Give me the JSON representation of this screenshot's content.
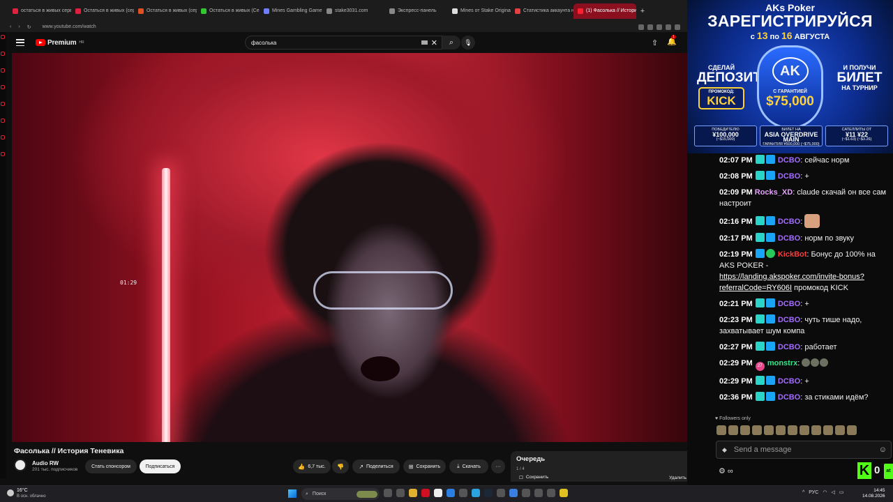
{
  "browser": {
    "tabs": [
      {
        "label": "остаться в живых серв",
        "color": "#e02040"
      },
      {
        "label": "Остаться в живых (сер",
        "color": "#e02040"
      },
      {
        "label": "Остаться в живых (серв",
        "color": "#e05020"
      },
      {
        "label": "Остаться в живых (Сер",
        "color": "#32c832"
      },
      {
        "label": "Mines Gambling Game b",
        "color": "#6f7dff"
      },
      {
        "label": "stake3031.com",
        "color": "#888888"
      },
      {
        "label": "Экспресс-панель",
        "color": "#888888"
      },
      {
        "label": "Mines от Stake Originals",
        "color": "#dddddd"
      },
      {
        "label": "Статистика аккаунта н",
        "color": "#e04040"
      },
      {
        "label": "(1) Фасолька // Истори",
        "color": "#ff2030",
        "active": true
      }
    ],
    "url": "www.youtube.com/watch"
  },
  "youtube": {
    "logo_text": "Premium",
    "logo_region": "HR",
    "search_query": "фасолька",
    "notif_count": "1",
    "overlay_time": "01:29",
    "video_title": "Фасолька // История Теневика",
    "channel_name": "Audio RW",
    "channel_subs": "201 тыс. подписчиков",
    "sponsor_label": "Стать спонсором",
    "subscribe_label": "Подписаться",
    "like_count": "6,7 тыс.",
    "share_label": "Поделиться",
    "save_label": "Сохранить",
    "download_label": "Скачать",
    "more_label": "···",
    "queue": {
      "title": "Очередь",
      "count": "1 / 4",
      "save_label": "Сохранить",
      "delete_label": "Удалить все"
    }
  },
  "ad": {
    "brand": "AKs Poker",
    "headline": "ЗАРЕГИСТРИРУЙСЯ",
    "date_prefix": "с",
    "date_from": "13",
    "date_mid": "по",
    "date_to": "16",
    "date_month": "АВГУСТА",
    "left_small": "СДЕЛАЙ",
    "left_big": "ДЕПОЗИТ",
    "promo_label": "ПРОМОКОД:",
    "promo_code": "KICK",
    "right_small": "И ПОЛУЧИ",
    "right_big": "БИЛЕТ",
    "right_sub": "НА ТУРНИР",
    "shield_logo": "AK",
    "guarantee_label": "С ГАРАНТИЕЙ",
    "guarantee_amount": "$75,000",
    "footer": [
      {
        "title": "ПОБЕДИТЕЛЮ",
        "value": "¥100,000",
        "sub": "(~$15,000)"
      },
      {
        "title": "БИЛЕТ НА",
        "value": "ASIA OVERDRIVE MAIN",
        "sub": "ГАРАНТИЯ ¥500,000 (~$75,000)"
      },
      {
        "title": "САТЕЛЛИТЫ ОТ",
        "value": "¥11  ¥22",
        "sub": "(~$1.63)  (~$3.26)"
      }
    ]
  },
  "chat": {
    "messages": [
      {
        "time": "02:07 PM",
        "user": "DCBO",
        "text": "сейчас норм"
      },
      {
        "time": "02:08 PM",
        "user": "DCBO",
        "text": "+"
      },
      {
        "time": "02:09 PM",
        "user": "Rocks_XD",
        "text": "claude скачай он все сам настроит"
      },
      {
        "time": "02:16 PM",
        "user": "DCBO",
        "text": ""
      },
      {
        "time": "02:17 PM",
        "user": "DCBO",
        "text": "норм по звуку"
      },
      {
        "time": "02:19 PM",
        "user": "KickBot",
        "text_pre": "Бонус до 100%% на AKS POKER -",
        "link": "https://landing.akspoker.com/invite-bonus?referralCode=RY606I",
        "text_post": "промокод KICK"
      },
      {
        "time": "02:21 PM",
        "user": "DCBO",
        "text": "+"
      },
      {
        "time": "02:23 PM",
        "user": "DCBO",
        "text": "чуть тише надо, захватывает шум компа"
      },
      {
        "time": "02:27 PM",
        "user": "DCBO",
        "text": "работает"
      },
      {
        "time": "02:29 PM",
        "user": "monstrx",
        "gift": "27",
        "text": ""
      },
      {
        "time": "02:29 PM",
        "user": "DCBO",
        "text": "+"
      },
      {
        "time": "02:36 PM",
        "user": "DCBO",
        "text": "за стиками идём?"
      }
    ],
    "followers_only": "Followers only",
    "input_placeholder": "Send a message",
    "footer_icon": "∞",
    "kick_count": "0",
    "kick_chip": "at"
  },
  "taskbar": {
    "temperature": "16°C",
    "weather": "В осн. облачно",
    "search_label": "Поиск",
    "lang": "РУС",
    "time": "14:45",
    "date": "14.08.2026"
  }
}
